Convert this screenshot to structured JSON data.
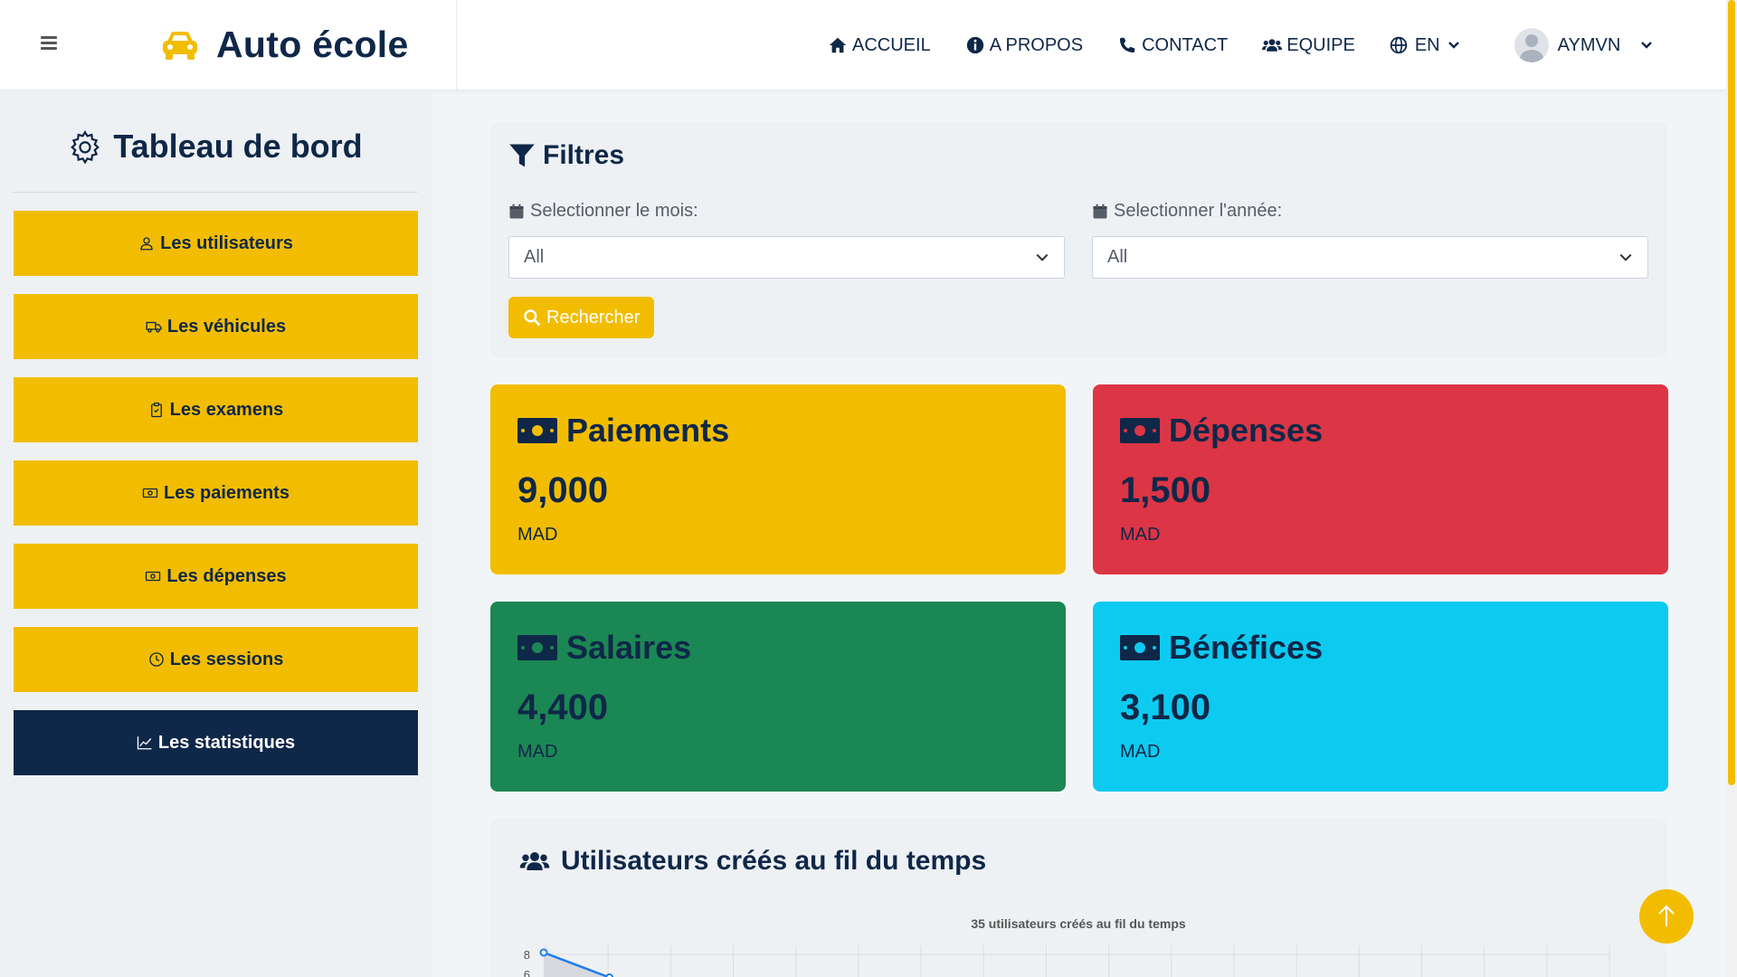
{
  "navbar": {
    "brand": "Auto école",
    "links": [
      {
        "label": "ACCUEIL",
        "icon": "home-icon"
      },
      {
        "label": "A PROPOS",
        "icon": "info-icon"
      },
      {
        "label": "CONTACT",
        "icon": "phone-icon"
      },
      {
        "label": "EQUIPE",
        "icon": "users-icon"
      }
    ],
    "language": "EN",
    "username": "AYMVN"
  },
  "sidebar": {
    "title": "Tableau de bord",
    "items": [
      {
        "label": "Les utilisateurs",
        "icon": "user-icon"
      },
      {
        "label": "Les véhicules",
        "icon": "truck-icon"
      },
      {
        "label": "Les examens",
        "icon": "clipboard-icon"
      },
      {
        "label": "Les paiements",
        "icon": "cash-icon"
      },
      {
        "label": "Les dépenses",
        "icon": "cash-icon"
      },
      {
        "label": "Les sessions",
        "icon": "clock-icon"
      },
      {
        "label": "Les statistiques",
        "icon": "chart-line-icon",
        "active": true
      }
    ]
  },
  "filters": {
    "title": "Filtres",
    "month_label": "Selectionner le mois:",
    "month_value": "All",
    "year_label": "Selectionner l'année:",
    "year_value": "All",
    "search_label": "Rechercher"
  },
  "cards": [
    {
      "title": "Paiements",
      "value": "9,000",
      "unit": "MAD",
      "color": "#f2bd00"
    },
    {
      "title": "Dépenses",
      "value": "1,500",
      "unit": "MAD",
      "color": "#dc3545"
    },
    {
      "title": "Salaires",
      "value": "4,400",
      "unit": "MAD",
      "color": "#1b8754"
    },
    {
      "title": "Bénéfices",
      "value": "3,100",
      "unit": "MAD",
      "color": "#0dcaf0"
    }
  ],
  "chart_section": {
    "title": "Utilisateurs créés au fil du temps"
  },
  "chart_data": {
    "type": "area",
    "title": "35 utilisateurs créés au fil du temps",
    "y_ticks": [
      "8",
      "6"
    ],
    "points": [
      8,
      5.5
    ],
    "color": "#1e7bf0"
  },
  "colors": {
    "accent": "#f2bd00",
    "navy": "#0f2748"
  }
}
